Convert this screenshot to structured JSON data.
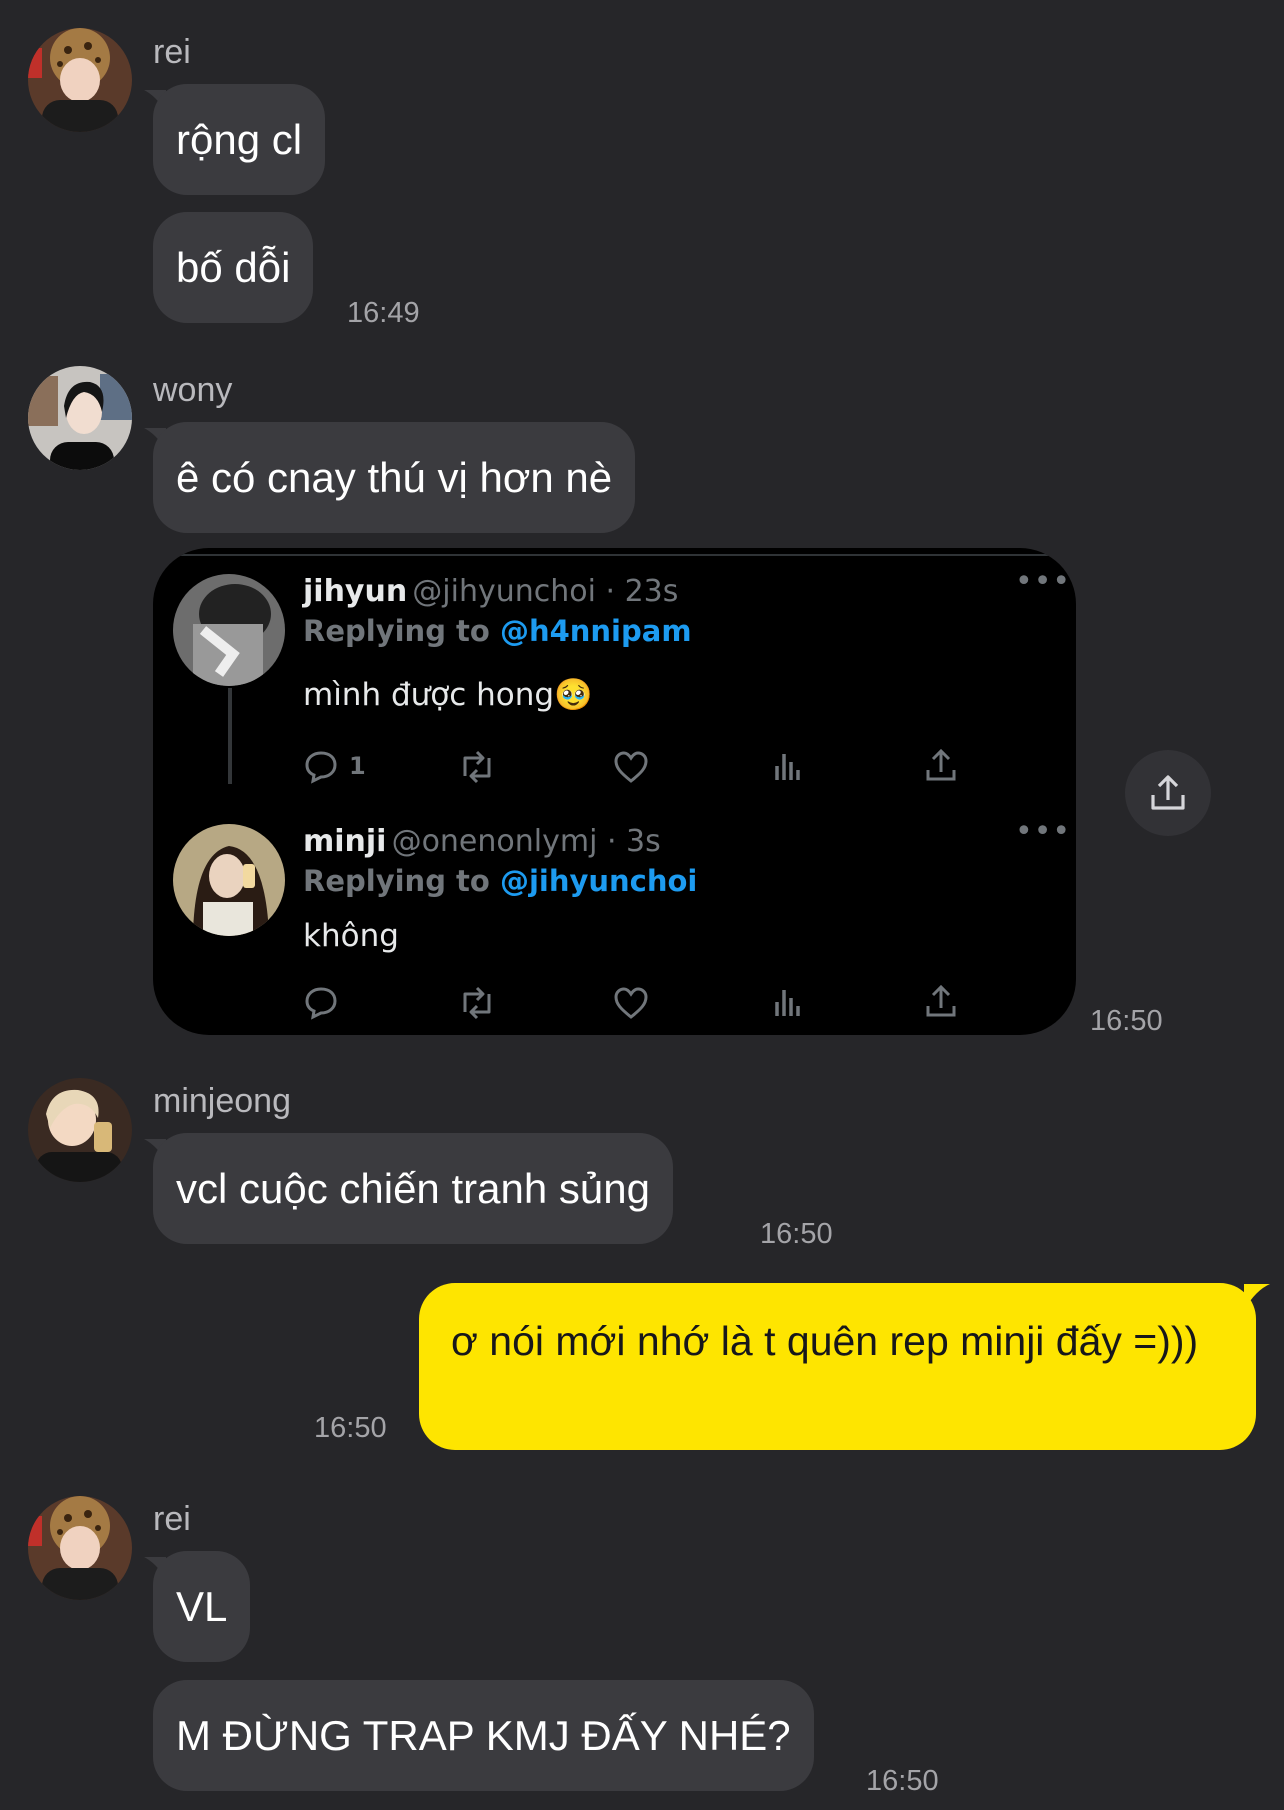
{
  "colors": {
    "background": "#262629",
    "bubble_incoming": "#3b3b3f",
    "bubble_outgoing": "#fee500",
    "timestamp": "#a4a4a8",
    "twitter_link": "#1d9bf0"
  },
  "messages": [
    {
      "sender": "rei",
      "avatar": "avatar-rei",
      "bubbles": [
        "rộng cl",
        "bố dỗi"
      ],
      "time": "16:49"
    },
    {
      "sender": "wony",
      "avatar": "avatar-wony",
      "bubbles": [
        "ê có cnay thú vị hơn nè"
      ],
      "time": "16:50",
      "attachment": {
        "type": "tweet-screenshot",
        "tweets": [
          {
            "name": "jihyun",
            "handle": "@jihyunchoi · 23s",
            "replying_prefix": "Replying to ",
            "replying_to": "@h4nnipam",
            "text": "mình được hong🥹",
            "reply_count": "1",
            "more_icon": "more-dots-icon"
          },
          {
            "name": "minji",
            "handle": "@onenonlymj · 3s",
            "replying_prefix": "Replying to ",
            "replying_to": "@jihyunchoi",
            "text": "không",
            "more_icon": "more-dots-icon"
          }
        ],
        "share_icon": "share-icon"
      }
    },
    {
      "sender": "minjeong",
      "avatar": "avatar-minjeong",
      "bubbles": [
        "vcl cuộc chiến tranh sủng"
      ],
      "time": "16:50"
    },
    {
      "sender": "me",
      "outgoing": true,
      "bubbles": [
        "ơ nói mới nhớ là t quên rep minji đấy =)))"
      ],
      "time": "16:50"
    },
    {
      "sender": "rei",
      "avatar": "avatar-rei",
      "bubbles": [
        "VL",
        "M ĐỪNG TRAP KMJ ĐẤY NHÉ?"
      ],
      "time": "16:50"
    }
  ]
}
